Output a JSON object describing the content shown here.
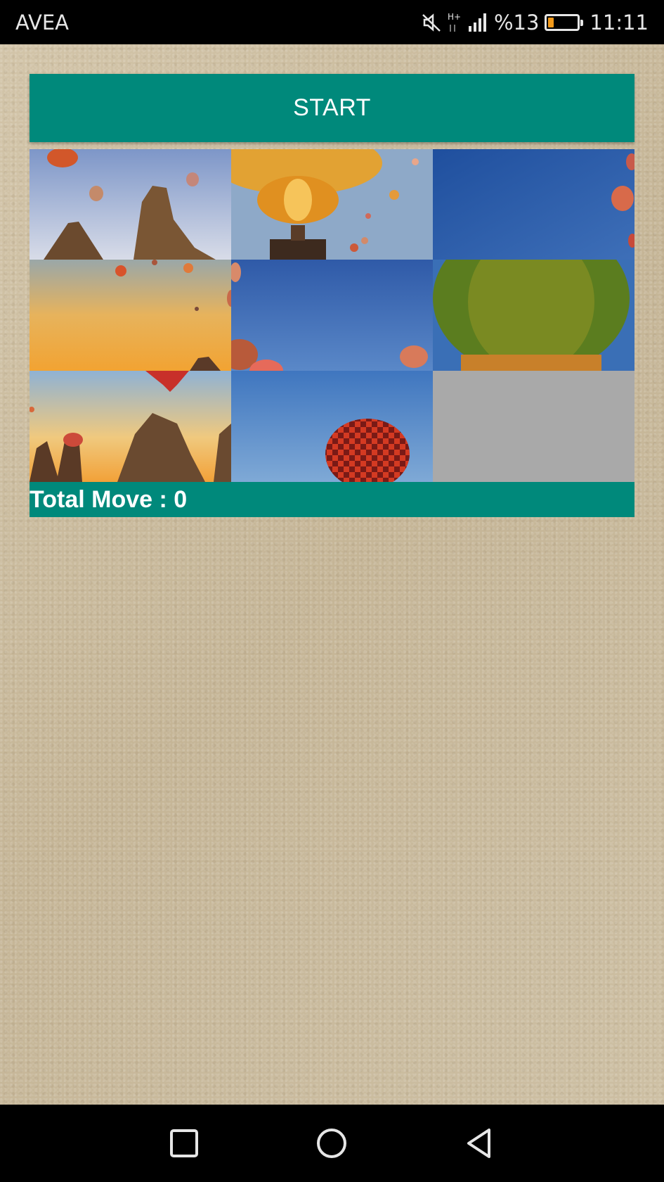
{
  "status_bar": {
    "carrier": "AVEA",
    "network": "H+",
    "battery_text": "%13",
    "battery_level": 0.13,
    "time": "11:11",
    "icons": [
      "mute-icon",
      "network-h-plus-icon",
      "signal-icon",
      "battery-icon"
    ]
  },
  "game": {
    "start_label": "START",
    "moves_label": "Total Move : 0",
    "grid": {
      "rows": 3,
      "cols": 3
    },
    "empty_tile_index": 8,
    "tiles": [
      {
        "description": "rock-chimneys-with-balloons"
      },
      {
        "description": "large-yellow-balloon-with-basket"
      },
      {
        "description": "blue-sky-with-balloons-edge"
      },
      {
        "description": "sunset-sky-with-balloons"
      },
      {
        "description": "blue-sky-with-striped-balloons"
      },
      {
        "description": "large-green-balloon"
      },
      {
        "description": "sunset-rocks-with-red-balloon"
      },
      {
        "description": "blue-sky-with-red-checkered-balloon"
      },
      {
        "description": "empty-tile"
      }
    ]
  },
  "nav_bar": {
    "icons": [
      "recents-square-icon",
      "home-circle-icon",
      "back-triangle-icon"
    ]
  },
  "colors": {
    "accent": "#00897b",
    "background": "#cbbc9f",
    "empty_tile": "#a9a9a9"
  }
}
